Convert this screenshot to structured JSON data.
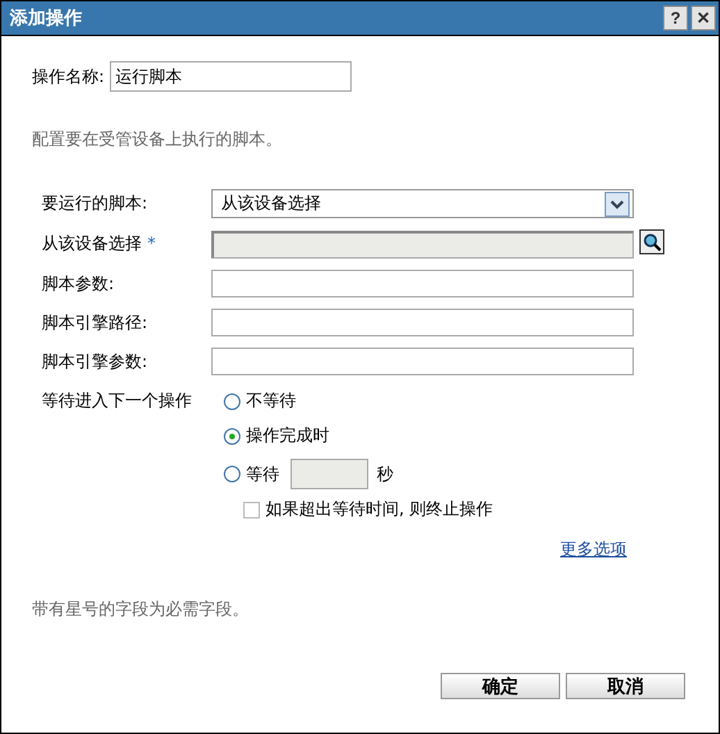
{
  "window": {
    "title": "添加操作",
    "help": "?",
    "close": "✕"
  },
  "action_name": {
    "label": "操作名称:",
    "value": "运行脚本"
  },
  "description": "配置要在受管设备上执行的脚本。",
  "fields": [
    {
      "kind": "select",
      "label": "要运行的脚本:",
      "value": "从该设备选择"
    },
    {
      "kind": "browse",
      "label": "从该设备选择",
      "required_mark": "*",
      "disabled": true
    },
    {
      "kind": "text",
      "label": "脚本参数:"
    },
    {
      "kind": "text",
      "label": "脚本引擎路径:"
    },
    {
      "kind": "text",
      "label": "脚本引擎参数:"
    }
  ],
  "wait": {
    "label": "等待进入下一个操作",
    "options": [
      {
        "label": "不等待",
        "selected": false
      },
      {
        "label": "操作完成时",
        "selected": true
      },
      {
        "label": "等待",
        "selected": false,
        "unit": "秒"
      }
    ],
    "terminate": {
      "label": "如果超出等待时间, 则终止操作",
      "checked": false
    }
  },
  "more_options": "更多选项",
  "required_note": "带有星号的字段为必需字段。",
  "buttons": [
    "确定",
    "取消"
  ]
}
